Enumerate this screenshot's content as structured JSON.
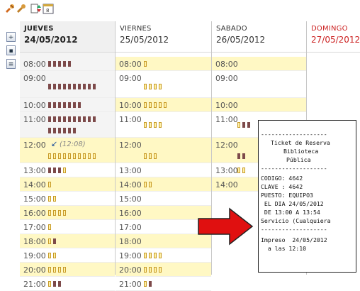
{
  "toolbar": {
    "icons": [
      "tools-icon",
      "calendar-icon"
    ]
  },
  "sidebar": {
    "buttons": [
      "add-icon",
      "day-view-icon",
      "week-view-icon"
    ]
  },
  "days": [
    {
      "name": "JUEVES",
      "date": "24/05/2012"
    },
    {
      "name": "VIERNES",
      "date": "25/05/2012"
    },
    {
      "name": "SABADO",
      "date": "26/05/2012"
    },
    {
      "name": "DOMINGO",
      "date": "27/05/2012"
    }
  ],
  "jueves_slots": [
    "08:00",
    "09:00",
    "10:00",
    "11:00",
    "12:00",
    "13:00",
    "14:00",
    "15:00",
    "16:00",
    "17:00",
    "18:00",
    "19:00",
    "20:00",
    "21:00"
  ],
  "now_marker": "(12:08)",
  "viernes_slots": [
    "08:00",
    "09:00",
    "10:00",
    "11:00",
    "12:00",
    "13:00",
    "14:00",
    "15:00",
    "16:00",
    "17:00",
    "18:00",
    "19:00",
    "20:00",
    "21:00"
  ],
  "sabado_slots": [
    "08:00",
    "09:00",
    "10:00",
    "11:00",
    "12:00",
    "13:00",
    "14:00"
  ],
  "ticket": {
    "sep": "-------------------",
    "title1": "Ticket de Reserva",
    "title2": "Biblioteca",
    "title3": "Pública",
    "codigo": "CODIGO: 4642",
    "clave": "CLAVE : 4642",
    "puesto": "PUESTO: EQUIPO3",
    "dia": " EL DIA 24/05/2012",
    "hora": " DE 13:00 A 13:54",
    "servicio": "Servicio (Cualquiera",
    "impreso": "Impreso  24/05/2012",
    "hora_impreso": "  a las 12:10"
  },
  "colors": {
    "available": "#fff8c4",
    "occupied": "#7d4a4a",
    "free_bar": "#fff1a6",
    "sunday": "#cc2222",
    "arrow": "#e01010"
  }
}
